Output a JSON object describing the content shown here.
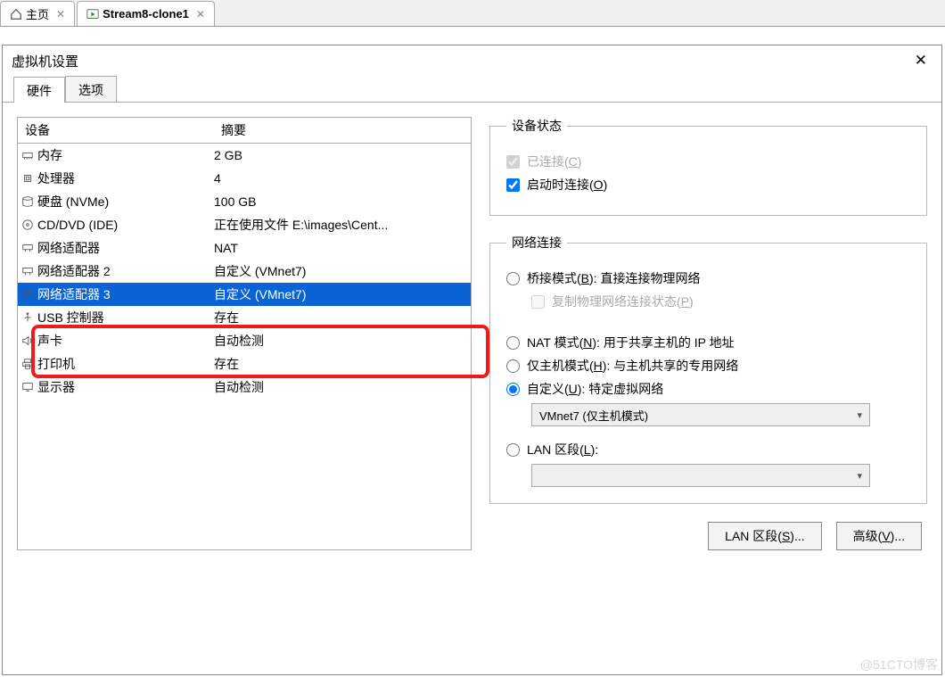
{
  "topTabs": {
    "home": "主页",
    "vm": "Stream8-clone1"
  },
  "dialog": {
    "title": "虚拟机设置",
    "tabs": {
      "hardware": "硬件",
      "options": "选项"
    }
  },
  "deviceList": {
    "headers": {
      "name": "设备",
      "summary": "摘要"
    },
    "rows": [
      {
        "icon": "memory-icon",
        "name": "内存",
        "summary": "2 GB"
      },
      {
        "icon": "cpu-icon",
        "name": "处理器",
        "summary": "4"
      },
      {
        "icon": "disk-icon",
        "name": "硬盘 (NVMe)",
        "summary": "100 GB"
      },
      {
        "icon": "cd-icon",
        "name": "CD/DVD (IDE)",
        "summary": "正在使用文件 E:\\images\\Cent..."
      },
      {
        "icon": "network-icon",
        "name": "网络适配器",
        "summary": "NAT"
      },
      {
        "icon": "network-icon",
        "name": "网络适配器 2",
        "summary": "自定义 (VMnet7)"
      },
      {
        "icon": "network-icon",
        "name": "网络适配器 3",
        "summary": "自定义 (VMnet7)",
        "selected": true
      },
      {
        "icon": "usb-icon",
        "name": "USB 控制器",
        "summary": "存在"
      },
      {
        "icon": "sound-icon",
        "name": "声卡",
        "summary": "自动检测"
      },
      {
        "icon": "printer-icon",
        "name": "打印机",
        "summary": "存在"
      },
      {
        "icon": "display-icon",
        "name": "显示器",
        "summary": "自动检测"
      }
    ]
  },
  "deviceStatus": {
    "legend": "设备状态",
    "connected": "已连接(",
    "connectedKey": "C",
    "connectAtPowerOn": "启动时连接(",
    "connectAtPowerOnKey": "O"
  },
  "network": {
    "legend": "网络连接",
    "bridged": "桥接模式(",
    "bridgedKey": "B",
    "bridgedSuffix": "): 直接连接物理网络",
    "replicate": "复制物理网络连接状态(",
    "replicateKey": "P",
    "nat": "NAT 模式(",
    "natKey": "N",
    "natSuffix": "): 用于共享主机的 IP 地址",
    "hostOnly": "仅主机模式(",
    "hostOnlyKey": "H",
    "hostOnlySuffix": "): 与主机共享的专用网络",
    "custom": "自定义(",
    "customKey": "U",
    "customSuffix": "): 特定虚拟网络",
    "customValue": "VMnet7 (仅主机模式)",
    "lan": "LAN 区段(",
    "lanKey": "L",
    "lanSuffix": "):"
  },
  "buttons": {
    "lanSegments": "LAN 区段(",
    "lanSegmentsKey": "S",
    "lanSegmentsSuffix": ")...",
    "advanced": "高级(",
    "advancedKey": "V",
    "advancedSuffix": ")..."
  },
  "watermark": "@51CTO博客"
}
